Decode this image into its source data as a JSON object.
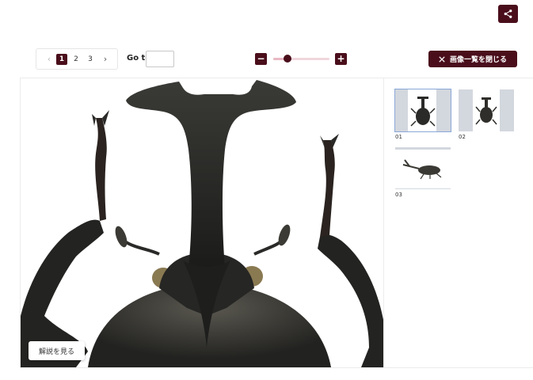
{
  "share": {
    "icon": "share-icon"
  },
  "pager": {
    "prev_icon": "‹",
    "next_icon": "›",
    "pages": [
      "1",
      "2",
      "3"
    ],
    "current": "1"
  },
  "goto": {
    "label": "Go to",
    "value": ""
  },
  "zoom": {
    "minus_label": "−",
    "plus_label": "+",
    "level": 0.25
  },
  "close_list": {
    "label": "画像一覧を閉じる",
    "icon": "close-icon"
  },
  "viewer": {
    "description_button": "解説を見る"
  },
  "thumbnails": [
    {
      "label": "01",
      "selected": true
    },
    {
      "label": "02",
      "selected": false
    },
    {
      "label": "03",
      "selected": false
    }
  ],
  "colors": {
    "accent": "#4a0e1b",
    "thumb_bg": "#d3d7de",
    "thumb_selected": "#8aa8d8"
  }
}
